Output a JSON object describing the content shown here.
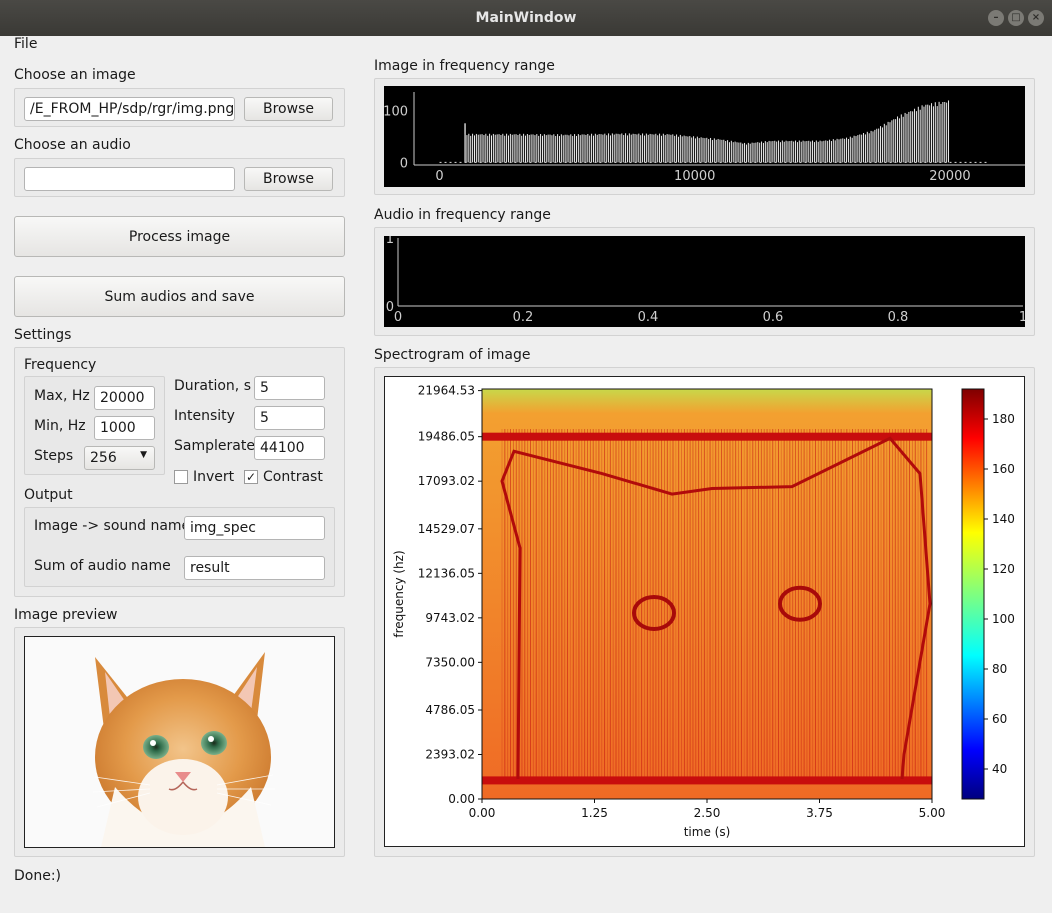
{
  "window": {
    "title": "MainWindow",
    "buttons": [
      "–",
      "□",
      "×"
    ]
  },
  "menu": {
    "file": "File"
  },
  "image_group": {
    "label": "Choose an image",
    "path_value": "/E_FROM_HP/sdp/rgr/img.png",
    "browse": "Browse"
  },
  "audio_group": {
    "label": "Choose an audio",
    "path_value": "",
    "browse": "Browse"
  },
  "actions": {
    "process": "Process image",
    "sum": "Sum audios and save"
  },
  "settings": {
    "label": "Settings",
    "frequency": {
      "label": "Frequency",
      "max_label": "Max, Hz",
      "max_value": "20000",
      "min_label": "Min, Hz",
      "min_value": "1000",
      "steps_label": "Steps",
      "steps_value": "256"
    },
    "duration_label": "Duration, s",
    "duration_value": "5",
    "intensity_label": "Intensity",
    "intensity_value": "5",
    "samplerate_label": "Samplerate",
    "samplerate_value": "44100",
    "invert_label": "Invert",
    "invert_checked": false,
    "contrast_label": "Contrast",
    "contrast_checked": true,
    "output": {
      "label": "Output",
      "sound_name_label": "Image -> sound name",
      "sound_name_value": "img_spec",
      "sum_name_label": "Sum of audio name",
      "sum_name_value": "result"
    }
  },
  "preview": {
    "label": "Image preview"
  },
  "status": "Done:)",
  "panels": {
    "image_freq": "Image in frequency range",
    "audio_freq": "Audio in frequency range",
    "spectrogram": "Spectrogram of image"
  },
  "chart_data": [
    {
      "type": "bar",
      "x_ticks": [
        "0",
        "10000",
        "20000"
      ],
      "y_ticks": [
        "0",
        "100"
      ],
      "xlim": [
        -1000,
        22000
      ],
      "ylim": [
        -5,
        135
      ],
      "x": [
        1000,
        3000,
        5000,
        7000,
        9000,
        11000,
        12000,
        13000,
        15000,
        16000,
        17000,
        18000,
        19000,
        20000
      ],
      "values": [
        55,
        55,
        54,
        56,
        55,
        45,
        37,
        42,
        42,
        48,
        62,
        90,
        112,
        120
      ]
    },
    {
      "type": "line",
      "x_ticks": [
        "0",
        "0.2",
        "0.4",
        "0.6",
        "0.8",
        "1"
      ],
      "y_ticks": [
        "0",
        "1"
      ],
      "xlim": [
        0,
        1
      ],
      "ylim": [
        0,
        1
      ]
    },
    {
      "type": "heatmap",
      "xlabel": "time (s)",
      "ylabel": "frequency (hz)",
      "x_ticks": [
        "0.00",
        "1.25",
        "2.50",
        "3.75",
        "5.00"
      ],
      "y_ticks": [
        "0.00",
        "2393.02",
        "4786.05",
        "7350.00",
        "9743.02",
        "12136.05",
        "14529.07",
        "17093.02",
        "19486.05",
        "21964.53"
      ],
      "xlim": [
        0,
        5
      ],
      "ylim": [
        0,
        22050
      ],
      "colorbar_ticks": [
        "40",
        "60",
        "80",
        "100",
        "120",
        "140",
        "160",
        "180"
      ],
      "colorbar_range": [
        28,
        192
      ],
      "colormap": "jet"
    }
  ]
}
